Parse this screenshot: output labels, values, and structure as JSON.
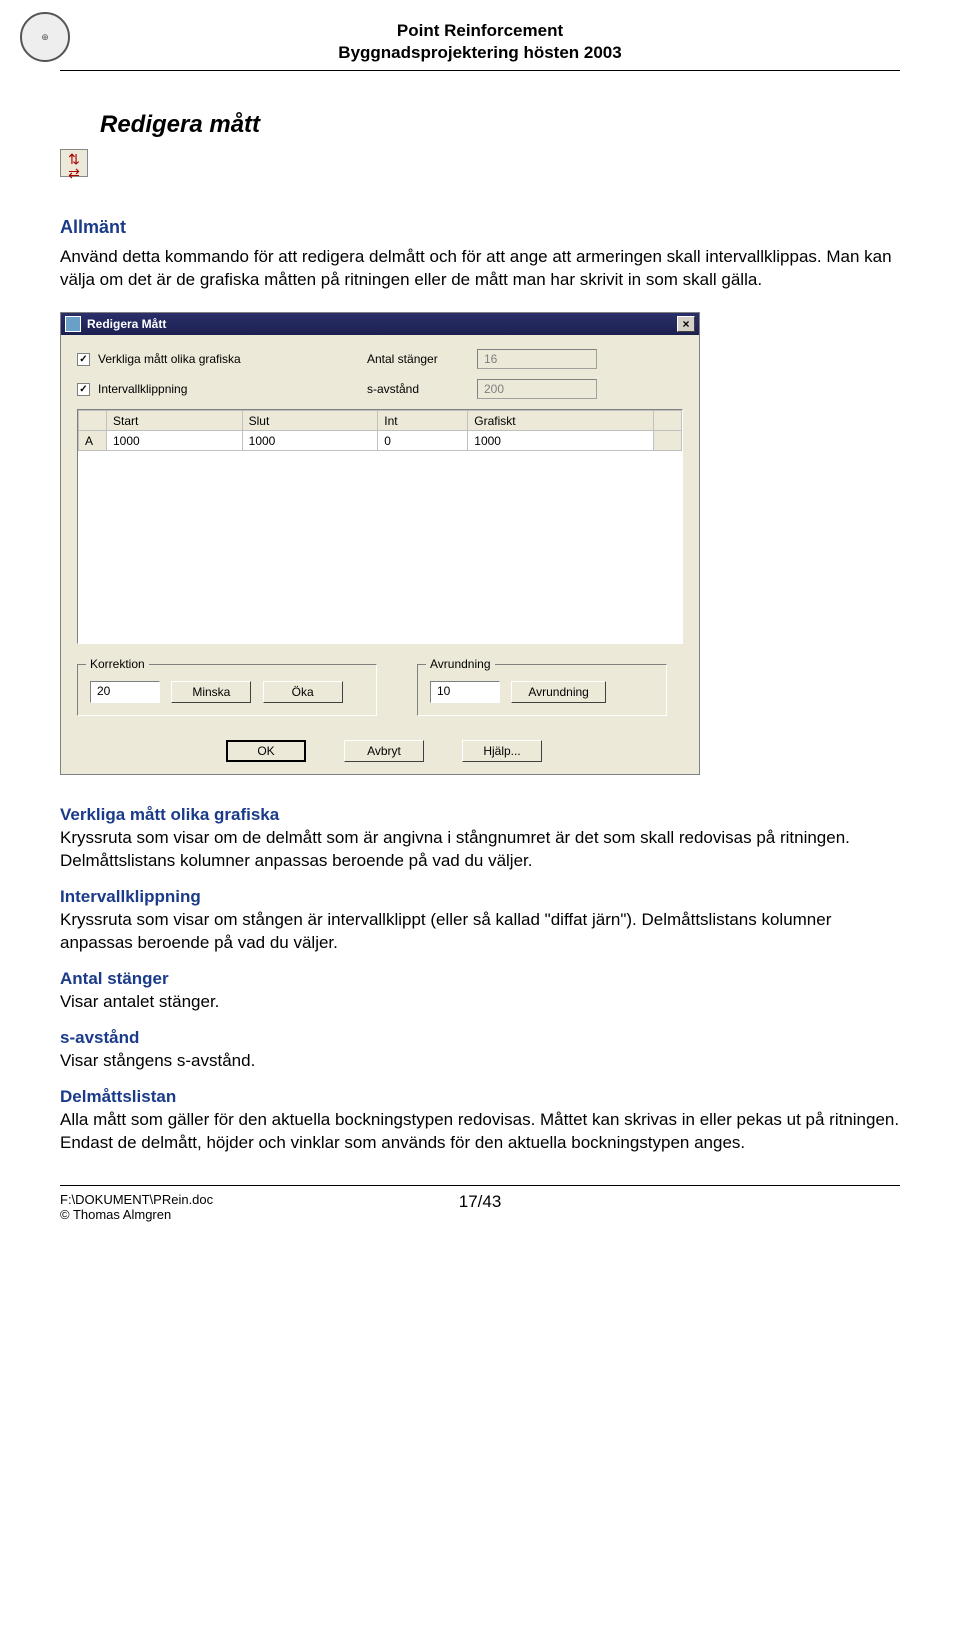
{
  "header": {
    "title1": "Point Reinforcement",
    "title2": "Byggnadsprojektering hösten 2003"
  },
  "section": {
    "title": "Redigera mått",
    "allmant_head": "Allmänt",
    "allmant_body": "Använd detta kommando för att redigera delmått och för att ange att armeringen skall intervallklippas. Man kan välja om det är de grafiska måtten på ritningen eller de mått man har skrivit in som skall gälla."
  },
  "dialog": {
    "title": "Redigera Mått",
    "chk_verkliga": "Verkliga mått olika grafiska",
    "chk_intervall": "Intervallklippning",
    "lbl_antal": "Antal stänger",
    "val_antal": "16",
    "lbl_savst": "s-avstånd",
    "val_savst": "200",
    "cols": {
      "c0": "",
      "c1": "Start",
      "c2": "Slut",
      "c3": "Int",
      "c4": "Grafiskt",
      "c5": ""
    },
    "row": {
      "r0": "A",
      "r1": "1000",
      "r2": "1000",
      "r3": "0",
      "r4": "1000"
    },
    "grp_korr": "Korrektion",
    "korr_val": "20",
    "btn_minska": "Minska",
    "btn_oka": "Öka",
    "grp_avr": "Avrundning",
    "avr_val": "10",
    "btn_avr": "Avrundning",
    "btn_ok": "OK",
    "btn_avbryt": "Avbryt",
    "btn_hjalp": "Hjälp..."
  },
  "defs": {
    "verkliga_h": "Verkliga mått olika grafiska",
    "verkliga_b": "Kryssruta som visar om de delmått som är angivna i stångnumret är det som skall redovisas på ritningen. Delmåttslistans kolumner anpassas beroende på vad du väljer.",
    "intervall_h": "Intervallklippning",
    "intervall_b": "Kryssruta som visar om stången är intervallklippt (eller så kallad \"diffat järn\"). Delmåttslistans kolumner anpassas beroende på vad du väljer.",
    "antal_h": "Antal stänger",
    "antal_b": "Visar antalet stänger.",
    "savst_h": "s-avstånd",
    "savst_b": "Visar stångens s-avstånd.",
    "lista_h": "Delmåttslistan",
    "lista_b": "Alla mått som gäller för den aktuella bockningstypen redovisas. Måttet kan skrivas in eller pekas ut på ritningen. Endast de delmått, höjder och vinklar som används för den aktuella bockningstypen anges."
  },
  "footer": {
    "path": "F:\\DOKUMENT\\PRein.doc",
    "copyright": "© Thomas Almgren",
    "page": "17/43"
  }
}
